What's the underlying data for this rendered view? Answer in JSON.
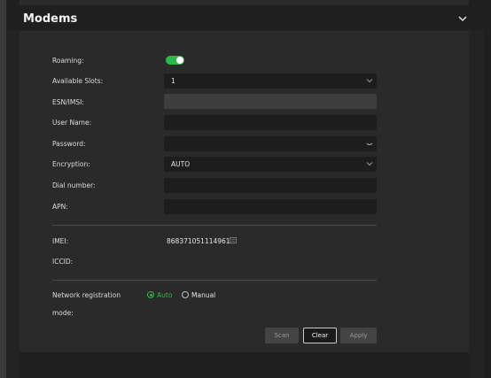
{
  "section": {
    "title": "Modems"
  },
  "form": {
    "roaming_label": "Roaming:",
    "roaming_on": true,
    "available_slots_label": "Available Slots:",
    "available_slots_value": "1",
    "esn_imsi_label": "ESN/IMSI:",
    "esn_imsi_value": "",
    "user_name_label": "User Name:",
    "user_name_value": "",
    "password_label": "Password:",
    "password_value": "",
    "encryption_label": "Encryption:",
    "encryption_value": "AUTO",
    "dial_number_label": "Dial number:",
    "dial_number_value": "",
    "apn_label": "APN:",
    "apn_value": ""
  },
  "info": {
    "imei_label": "IMEI:",
    "imei_value": "868371051114961",
    "iccid_label": "ICCID:",
    "iccid_value": ""
  },
  "network": {
    "label_line1": "Network registration",
    "label_line2": "mode:",
    "option_auto": "Auto",
    "option_manual": "Manual",
    "selected": "Auto"
  },
  "buttons": {
    "scan": "Scan",
    "clear": "Clear",
    "apply": "Apply"
  },
  "colors": {
    "accent": "#2fb84a",
    "background": "#1f1f1f",
    "panel": "#2a2a2a"
  },
  "icons": [
    "chevron-down-icon",
    "eye-icon",
    "copy-icon"
  ]
}
